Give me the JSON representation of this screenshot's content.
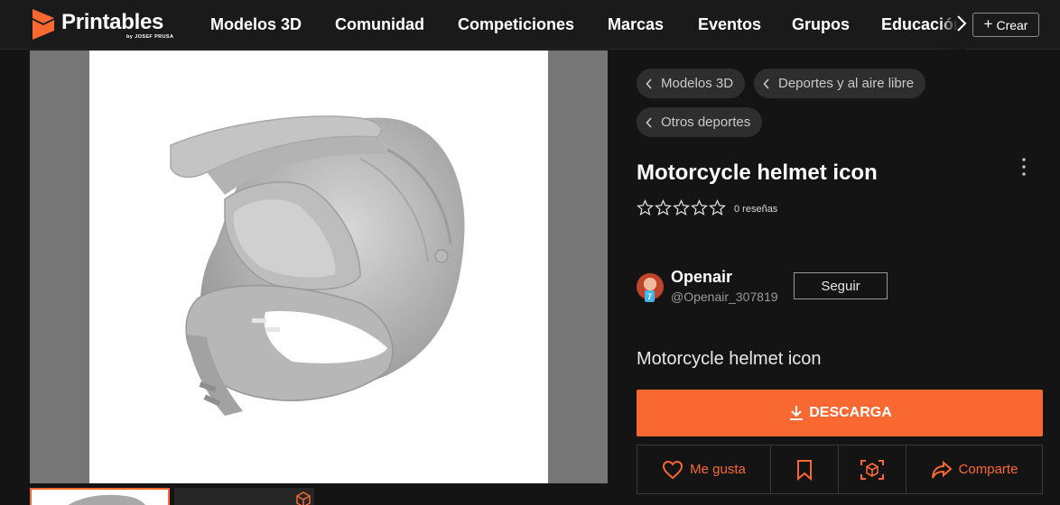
{
  "brand": {
    "name": "Printables",
    "tagline": "by JOSEF PRUSA",
    "accent": "#fa6831"
  },
  "nav": {
    "items": [
      "Modelos 3D",
      "Comunidad",
      "Competiciones",
      "Marcas",
      "Eventos",
      "Grupos",
      "Educación"
    ],
    "more_icon": "chevron-right-icon",
    "create_label": "Crear"
  },
  "breadcrumbs": [
    "Modelos 3D",
    "Deportes y al aire libre",
    "Otros deportes"
  ],
  "model": {
    "title": "Motorcycle helmet icon",
    "rating_stars": 0,
    "rating_max": 5,
    "reviews_label": "0 reseñas",
    "summary": "Motorcycle helmet icon"
  },
  "author": {
    "name": "Openair",
    "handle": "@Openair_307819",
    "level_badge": "7",
    "follow_label": "Seguir"
  },
  "actions": {
    "download_label": "DESCARGA",
    "like_label": "Me gusta",
    "share_label": "Comparte"
  }
}
